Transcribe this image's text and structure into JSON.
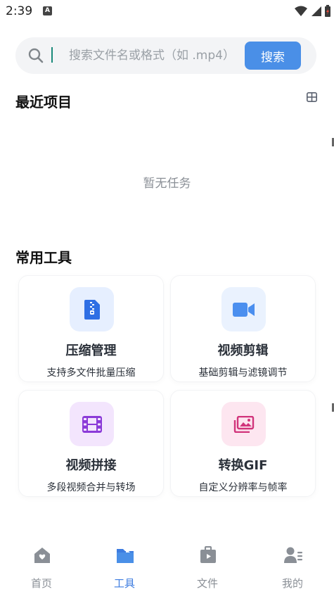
{
  "status_bar": {
    "time": "2:39",
    "app_icon_letter": "A"
  },
  "search": {
    "placeholder": "搜索文件名或格式（如 .mp4）",
    "value": "",
    "button_label": "搜索"
  },
  "recent": {
    "title": "最近项目",
    "empty_text": "暂无任务"
  },
  "tools": {
    "title": "常用工具",
    "items": [
      {
        "name": "压缩管理",
        "desc": "支持多文件批量压缩",
        "icon": "zip-file-icon",
        "color": "#2f6fe4",
        "bg": "#e6efff"
      },
      {
        "name": "视频剪辑",
        "desc": "基础剪辑与滤镜调节",
        "icon": "video-camera-icon",
        "color": "#4b8fef",
        "bg": "#eaf2fe"
      },
      {
        "name": "视频拼接",
        "desc": "多段视频合并与转场",
        "icon": "film-strip-icon",
        "color": "#8b3ad8",
        "bg": "#f3e5fd"
      },
      {
        "name": "转换GIF",
        "desc": "自定义分辨率与帧率",
        "icon": "image-gallery-icon",
        "color": "#d1347b",
        "bg": "#fde6f0"
      }
    ]
  },
  "bottom_nav": {
    "items": [
      {
        "label": "首页",
        "icon": "home-icon",
        "active": false
      },
      {
        "label": "工具",
        "icon": "folder-icon",
        "active": true
      },
      {
        "label": "文件",
        "icon": "file-box-icon",
        "active": false
      },
      {
        "label": "我的",
        "icon": "profile-icon",
        "active": false
      }
    ]
  },
  "colors": {
    "accent": "#4a8fe7",
    "active_nav": "#3d7ce0",
    "inactive_nav": "#8a8f96"
  }
}
